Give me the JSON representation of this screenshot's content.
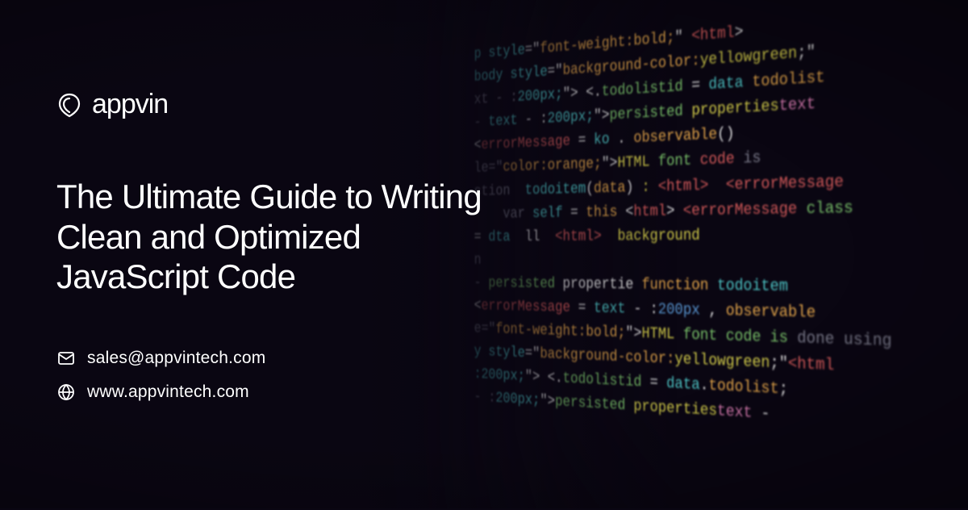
{
  "brand": {
    "name": "appvin"
  },
  "headline": "The Ultimate Guide to Writing Clean and Optimized JavaScript Code",
  "contact": {
    "email": "sales@appvintech.com",
    "website": "www.appvintech.com"
  },
  "bg_lines": [
    {
      "segments": [
        {
          "t": "p style",
          "c": "c-cyan"
        },
        {
          "t": "=\"",
          "c": "c-white"
        },
        {
          "t": "font-weight:bold;",
          "c": "c-orange"
        },
        {
          "t": "\" ",
          "c": "c-white"
        },
        {
          "t": "<html",
          "c": "c-red"
        },
        {
          "t": ">",
          "c": "c-white"
        }
      ]
    },
    {
      "segments": [
        {
          "t": "body style",
          "c": "c-cyan"
        },
        {
          "t": "=\"",
          "c": "c-white"
        },
        {
          "t": "background-color:",
          "c": "c-orange"
        },
        {
          "t": "yellowgreen",
          "c": "c-yellow"
        },
        {
          "t": ";\"",
          "c": "c-white"
        }
      ]
    },
    {
      "segments": [
        {
          "t": "xt - :",
          "c": "c-dim"
        },
        {
          "t": "200px;",
          "c": "c-cyan"
        },
        {
          "t": "\"> <.",
          "c": "c-white"
        },
        {
          "t": "todolistid",
          "c": "c-green"
        },
        {
          "t": " = ",
          "c": "c-white"
        },
        {
          "t": "data",
          "c": "c-cyan"
        },
        {
          "t": " todolist",
          "c": "c-orange"
        }
      ]
    },
    {
      "segments": [
        {
          "t": "- ",
          "c": "c-dim"
        },
        {
          "t": "text",
          "c": "c-cyan"
        },
        {
          "t": " - :",
          "c": "c-white"
        },
        {
          "t": "200px;",
          "c": "c-cyan"
        },
        {
          "t": "\">",
          "c": "c-white"
        },
        {
          "t": "persisted ",
          "c": "c-green"
        },
        {
          "t": "properties",
          "c": "c-yellow"
        },
        {
          "t": "text",
          "c": "c-pink"
        }
      ]
    },
    {
      "segments": [
        {
          "t": "<",
          "c": "c-white"
        },
        {
          "t": "errorMessage",
          "c": "c-red"
        },
        {
          "t": " = ",
          "c": "c-white"
        },
        {
          "t": "ko",
          "c": "c-cyan"
        },
        {
          "t": " . ",
          "c": "c-white"
        },
        {
          "t": "observable",
          "c": "c-orange"
        },
        {
          "t": "()",
          "c": "c-white"
        }
      ]
    },
    {
      "segments": [
        {
          "t": "le=\"",
          "c": "c-dim"
        },
        {
          "t": "color:orange;",
          "c": "c-orange"
        },
        {
          "t": "\">",
          "c": "c-white"
        },
        {
          "t": "HTML",
          "c": "c-yellow"
        },
        {
          "t": " font ",
          "c": "c-green"
        },
        {
          "t": "code",
          "c": "c-red"
        },
        {
          "t": " is",
          "c": "c-dim"
        }
      ]
    },
    {
      "segments": [
        {
          "t": "ction  ",
          "c": "c-dim"
        },
        {
          "t": "todoitem",
          "c": "c-cyan"
        },
        {
          "t": "(",
          "c": "c-white"
        },
        {
          "t": "data",
          "c": "c-orange"
        },
        {
          "t": ") ",
          "c": "c-white"
        },
        {
          "t": ": ",
          "c": "c-yellow"
        },
        {
          "t": "<html>",
          "c": "c-red"
        },
        {
          "t": "  ",
          "c": "c-white"
        },
        {
          "t": "<errorMessage",
          "c": "c-red"
        }
      ]
    },
    {
      "segments": [
        {
          "t": "    var ",
          "c": "c-dim"
        },
        {
          "t": "self",
          "c": "c-cyan"
        },
        {
          "t": " = ",
          "c": "c-white"
        },
        {
          "t": "this",
          "c": "c-orange"
        },
        {
          "t": " <",
          "c": "c-white"
        },
        {
          "t": "html",
          "c": "c-red"
        },
        {
          "t": "> ",
          "c": "c-white"
        },
        {
          "t": "<errorMessage",
          "c": "c-red"
        },
        {
          "t": " class",
          "c": "c-green"
        }
      ]
    },
    {
      "segments": [
        {
          "t": "= ",
          "c": "c-white"
        },
        {
          "t": "dta  ",
          "c": "c-cyan"
        },
        {
          "t": "ll  ",
          "c": "c-white"
        },
        {
          "t": "<html>",
          "c": "c-red"
        },
        {
          "t": "  ",
          "c": "c-white"
        },
        {
          "t": "background",
          "c": "c-yellow"
        }
      ]
    },
    {
      "segments": [
        {
          "t": "n",
          "c": "c-dim"
        }
      ]
    },
    {
      "segments": [
        {
          "t": "- ",
          "c": "c-dim"
        },
        {
          "t": "persisted",
          "c": "c-green"
        },
        {
          "t": " propertie ",
          "c": "c-white"
        },
        {
          "t": "function",
          "c": "c-orange"
        },
        {
          "t": " todoitem",
          "c": "c-cyan"
        }
      ]
    },
    {
      "segments": [
        {
          "t": "<",
          "c": "c-white"
        },
        {
          "t": "errorMessage",
          "c": "c-red"
        },
        {
          "t": " = ",
          "c": "c-white"
        },
        {
          "t": "text",
          "c": "c-cyan"
        },
        {
          "t": " - :",
          "c": "c-white"
        },
        {
          "t": "200px",
          "c": "c-blue"
        },
        {
          "t": " , ",
          "c": "c-white"
        },
        {
          "t": "observable",
          "c": "c-orange"
        }
      ]
    },
    {
      "segments": [
        {
          "t": "e=\"",
          "c": "c-dim"
        },
        {
          "t": "font-weight:bold;",
          "c": "c-orange"
        },
        {
          "t": "\">",
          "c": "c-white"
        },
        {
          "t": "HTML",
          "c": "c-yellow"
        },
        {
          "t": " font code is ",
          "c": "c-green"
        },
        {
          "t": "done using",
          "c": "c-dim"
        }
      ]
    },
    {
      "segments": [
        {
          "t": "y style",
          "c": "c-cyan"
        },
        {
          "t": "=\"",
          "c": "c-white"
        },
        {
          "t": "background-color:",
          "c": "c-orange"
        },
        {
          "t": "yellowgreen",
          "c": "c-yellow"
        },
        {
          "t": ";\"",
          "c": "c-white"
        },
        {
          "t": "<html",
          "c": "c-red"
        }
      ]
    },
    {
      "segments": [
        {
          "t": ":200px;",
          "c": "c-cyan"
        },
        {
          "t": "\"> <.",
          "c": "c-white"
        },
        {
          "t": "todolistid",
          "c": "c-green"
        },
        {
          "t": " = ",
          "c": "c-white"
        },
        {
          "t": "data",
          "c": "c-cyan"
        },
        {
          "t": ".",
          "c": "c-white"
        },
        {
          "t": "todolist",
          "c": "c-orange"
        },
        {
          "t": ";",
          "c": "c-white"
        }
      ]
    },
    {
      "segments": [
        {
          "t": "- :",
          "c": "c-dim"
        },
        {
          "t": "200px;",
          "c": "c-cyan"
        },
        {
          "t": "\">",
          "c": "c-white"
        },
        {
          "t": "persisted ",
          "c": "c-green"
        },
        {
          "t": "properties",
          "c": "c-yellow"
        },
        {
          "t": "text",
          "c": "c-pink"
        },
        {
          "t": " -",
          "c": "c-white"
        }
      ]
    }
  ]
}
